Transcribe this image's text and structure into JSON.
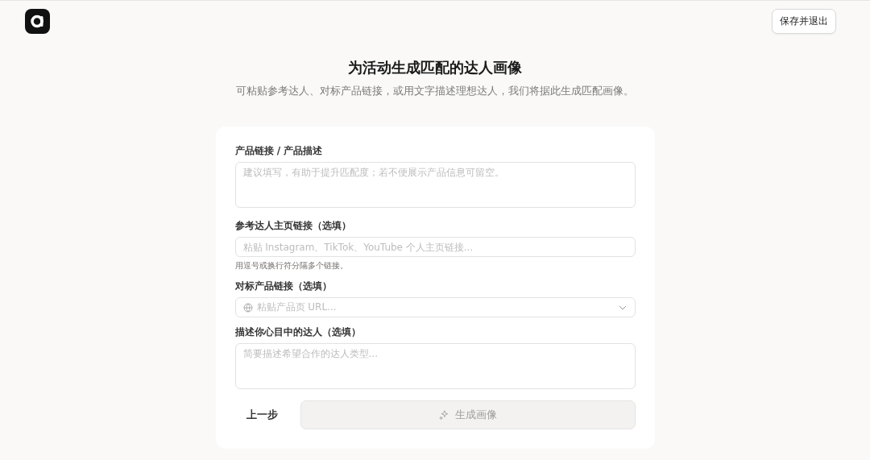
{
  "header": {
    "save_button": "保存并退出"
  },
  "title": "为活动生成匹配的达人画像",
  "subtitle": "可粘贴参考达人、对标产品链接，或用文字描述理想达人，我们将据此生成匹配画像。",
  "fields": [
    {
      "kind": "textarea",
      "label": "产品链接 / 产品描述",
      "placeholder": "建议填写，有助于提升匹配度；若不便展示产品信息可留空。"
    },
    {
      "kind": "input",
      "label": "参考达人主页链接（选填）",
      "placeholder": "粘贴 Instagram、TikTok、YouTube 个人主页链接...",
      "hint": "用逗号或换行符分隔多个链接。"
    },
    {
      "kind": "select",
      "label": "对标产品链接（选填）",
      "placeholder": "粘贴产品页 URL..."
    },
    {
      "kind": "textarea",
      "label": "描述你心目中的达人（选填）",
      "placeholder": "简要描述希望合作的达人类型..."
    }
  ],
  "back_button": "上一步",
  "generate_button": {
    "label": "生成画像",
    "disabled": true
  }
}
